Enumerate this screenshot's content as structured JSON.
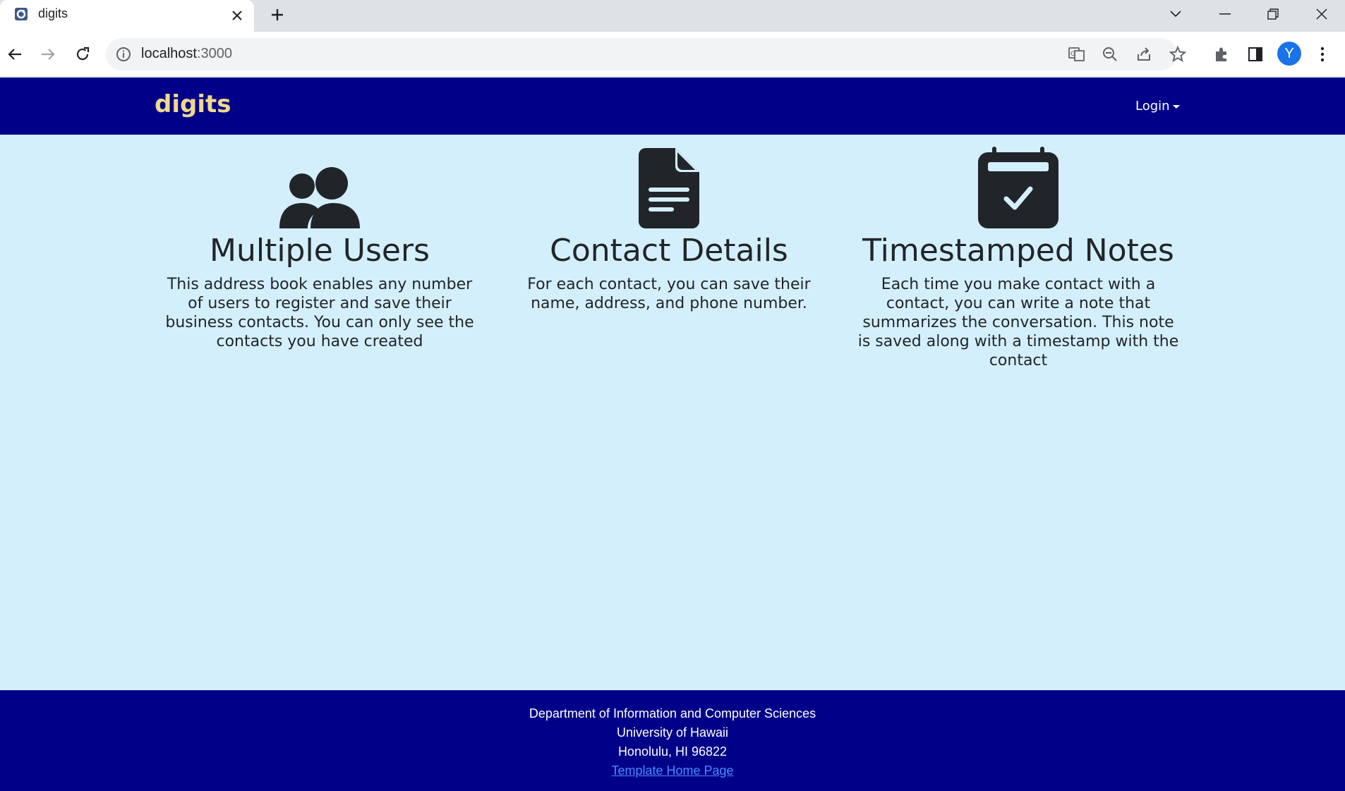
{
  "browser": {
    "tab_title": "digits",
    "url_host": "localhost",
    "url_port": ":3000",
    "profile_initial": "Y"
  },
  "navbar": {
    "brand": "digits",
    "login_label": "Login"
  },
  "features": [
    {
      "icon": "users-icon",
      "title": "Multiple Users",
      "text": "This address book enables any number of users to register and save their business contacts. You can only see the contacts you have created"
    },
    {
      "icon": "file-icon",
      "title": "Contact Details",
      "text": "For each contact, you can save their name, address, and phone number."
    },
    {
      "icon": "calendar-check-icon",
      "title": "Timestamped Notes",
      "text": "Each time you make contact with a contact, you can write a note that summarizes the conversation. This note is saved along with a timestamp with the contact"
    }
  ],
  "footer": {
    "line1": "Department of Information and Computer Sciences",
    "line2": "University of Hawaii",
    "line3": "Honolulu, HI 96822",
    "link": "Template Home Page"
  },
  "colors": {
    "navbar_bg": "#000089",
    "brand": "#f0d98a",
    "page_bg": "#d4effc"
  }
}
